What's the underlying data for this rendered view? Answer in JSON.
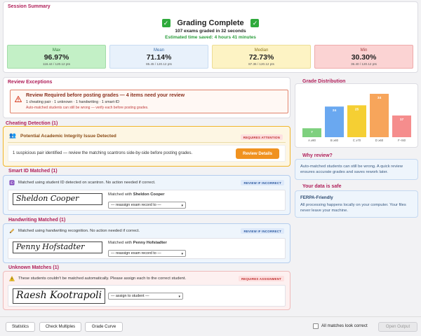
{
  "summary": {
    "section_title": "Session Summary",
    "title": "Grading Complete",
    "subtitle": "107 exams graded in 32 seconds",
    "saved": "Estimated time saved: 4 hours 41 minutes",
    "stats": {
      "max": {
        "label": "Max",
        "value": "96.97%",
        "pts": "116.44 / 120.12 pts"
      },
      "mean": {
        "label": "Mean",
        "value": "71.14%",
        "pts": "85.45 / 120.12 pts"
      },
      "median": {
        "label": "Median",
        "value": "72.73%",
        "pts": "87.36 / 120.12 pts"
      },
      "min": {
        "label": "Min",
        "value": "30.30%",
        "pts": "36.40 / 120.12 pts"
      }
    }
  },
  "review": {
    "section_title": "Review Exceptions",
    "title": "Review Required before posting grades — 4 items need your review",
    "tags": "1 cheating pair  ·  1 unknown  ·  1 handwriting  ·  1 smart-ID",
    "note": "Auto-matched students can still be wrong — verify each before posting grades."
  },
  "cheating": {
    "section_title": "Cheating Detection (1)",
    "title": "Potential Academic Integrity Issue Detected",
    "badge": "REQUIRES ATTENTION",
    "text": "1 suspicious pair identified — review the matching scantrons side-by-side before posting grades.",
    "button": "Review Details"
  },
  "smart_id": {
    "section_title": "Smart ID Matched (1)",
    "desc": "Matched using student ID detected on scantron. No action needed if correct.",
    "badge": "REVIEW IF INCORRECT",
    "signature": "Sheldon Cooper",
    "matched_prefix": "Matched with ",
    "matched_name": "Sheldon Cooper",
    "select": "— reassign exam record to —"
  },
  "handwriting": {
    "section_title": "Handwriting Matched (1)",
    "desc": "Matched using handwriting recognition. No action needed if correct.",
    "badge": "REVIEW IF INCORRECT",
    "signature": "Penny Hofstadter",
    "matched_prefix": "Matched with ",
    "matched_name": "Penny Hofstadter",
    "select": "— reassign exam record to —"
  },
  "unknown": {
    "section_title": "Unknown Matches (1)",
    "desc": "These students couldn't be matched automatically. Please assign each to the correct student.",
    "badge": "REQUIRES ASSIGNMENT",
    "signature": "Raesh Kootrapoli",
    "select": "— assign to student —"
  },
  "grade_distribution": {
    "section_title": "Grade Distribution"
  },
  "chart_data": {
    "type": "bar",
    "categories": [
      "A ≥90",
      "B ≥80",
      "C ≥70",
      "D ≥60",
      "F <60"
    ],
    "values": [
      7,
      24,
      25,
      34,
      17
    ],
    "colors": [
      "#7ed07e",
      "#6aa8f0",
      "#f5cf33",
      "#f7a55b",
      "#f58d8d"
    ],
    "ylim": [
      0,
      34
    ]
  },
  "why": {
    "section_title": "Why review?",
    "text": "Auto-matched students can still be wrong. A quick review ensures accurate grades and saves rework later."
  },
  "safe": {
    "section_title": "Your data is safe",
    "head": "FERPA-Friendly",
    "text": "All processing happens locally on your computer. Your files never leave your machine."
  },
  "footer": {
    "statistics": "Statistics",
    "check_multiples": "Check Multiples",
    "grade_curve": "Grade Curve",
    "all_correct": "All matches look correct",
    "open_output": "Open Output"
  }
}
